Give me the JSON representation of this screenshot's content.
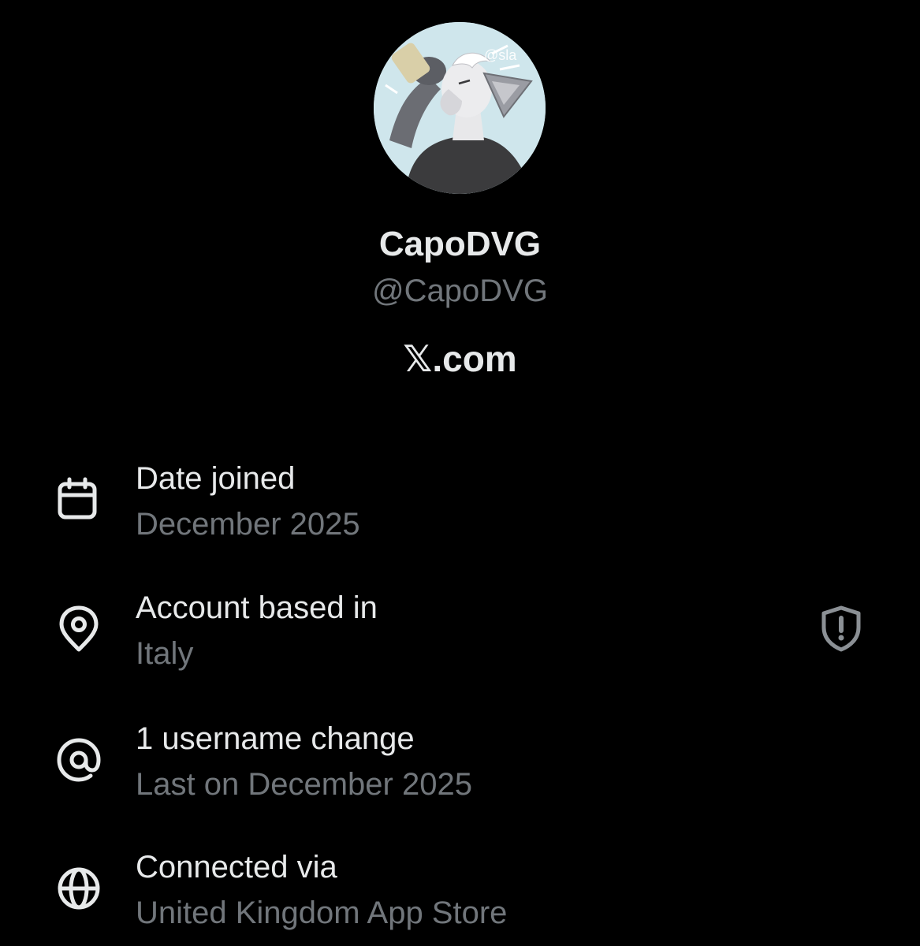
{
  "profile": {
    "display_name": "CapoDVG",
    "handle": "@CapoDVG",
    "domain": "𝕏.com",
    "avatar_watermark": "@sla"
  },
  "rows": [
    {
      "icon": "calendar-icon",
      "title": "Date joined",
      "value": "December 2025"
    },
    {
      "icon": "location-pin-icon",
      "title": "Account based in",
      "value": "Italy",
      "badge_icon": "shield-alert-icon"
    },
    {
      "icon": "at-sign-icon",
      "title": "1 username change",
      "value": "Last on December 2025"
    },
    {
      "icon": "globe-icon",
      "title": "Connected via",
      "value": "United Kingdom App Store"
    }
  ],
  "colors": {
    "background": "#000000",
    "primary_text": "#e7e9ea",
    "secondary_text": "#71767b"
  }
}
